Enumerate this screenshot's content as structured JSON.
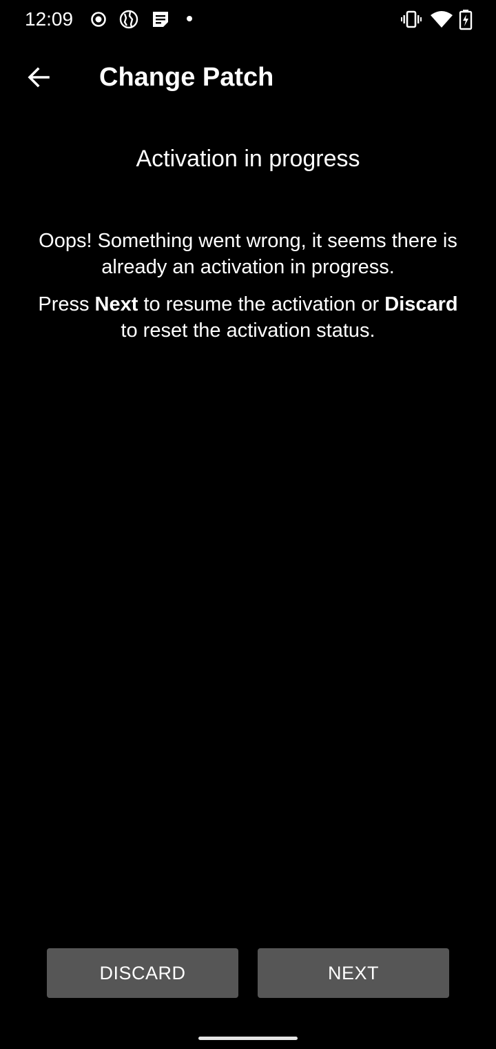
{
  "status_bar": {
    "time": "12:09",
    "left_icons": [
      "radio-button-icon",
      "vpn-globe-icon",
      "notes-icon",
      "dot-icon"
    ],
    "right_icons": [
      "vibrate-icon",
      "wifi-icon",
      "battery-charging-icon"
    ]
  },
  "app_bar": {
    "back_icon": "arrow-back-icon",
    "title": "Change Patch"
  },
  "main": {
    "heading": "Activation in progress",
    "message": "Oops! Something went wrong, it seems there is already an activation in progress.",
    "instructions": {
      "part1": "Press ",
      "next_word": "Next",
      "part2": " to resume the activation or ",
      "discard_word": "Discard",
      "part3": " to reset the activation status."
    }
  },
  "actions": {
    "discard_label": "DISCARD",
    "next_label": "NEXT",
    "button_color": "#565656"
  },
  "colors": {
    "background": "#000000",
    "text": "#ffffff"
  }
}
